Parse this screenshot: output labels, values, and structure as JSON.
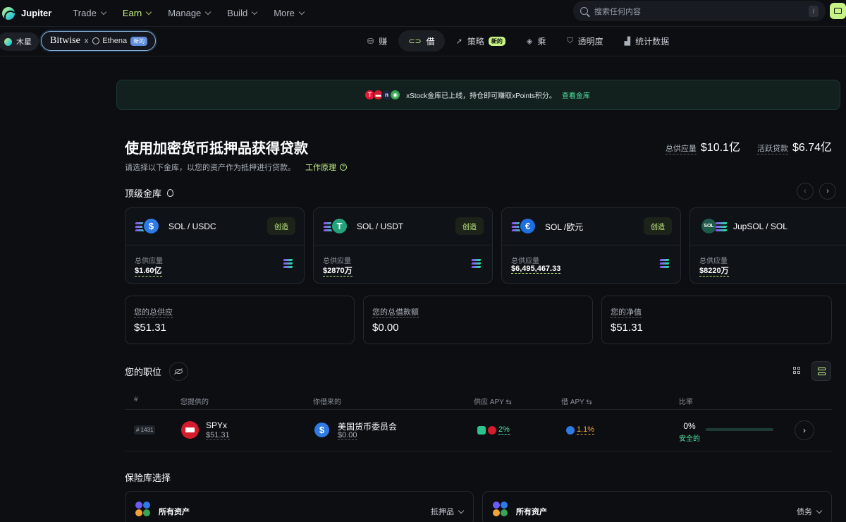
{
  "brand": {
    "name": "Jupiter"
  },
  "nav": [
    {
      "label": "Trade",
      "active": false
    },
    {
      "label": "Earn",
      "active": true
    },
    {
      "label": "Manage",
      "active": false
    },
    {
      "label": "Build",
      "active": false
    },
    {
      "label": "More",
      "active": false
    }
  ],
  "search": {
    "placeholder": "搜索任何内容",
    "shortcut": "/"
  },
  "subnav": {
    "chip_jupiter": "木星",
    "partner": {
      "left": "Bitwise",
      "x": "x",
      "right": "Ethena",
      "badge": "新的"
    },
    "tabs": [
      {
        "label": "赚",
        "icon": "coins-icon",
        "active": false,
        "badge": ""
      },
      {
        "label": "借",
        "icon": "link-icon",
        "active": true,
        "badge": ""
      },
      {
        "label": "策略",
        "icon": "rocket-icon",
        "active": false,
        "badge": "新的"
      },
      {
        "label": "乘",
        "icon": "layers-icon",
        "active": false,
        "badge": ""
      },
      {
        "label": "透明度",
        "icon": "shield-icon",
        "active": false,
        "badge": ""
      },
      {
        "label": "统计数据",
        "icon": "bar-chart-icon",
        "active": false,
        "badge": ""
      }
    ]
  },
  "banner": {
    "text": "xStock金库已上线，持仓即可赚取xPoints积分。",
    "link": "查看金库"
  },
  "hero": {
    "title": "使用加密货币抵押品获得贷款",
    "subtitle": "请选择以下金库，以您的资产作为抵押进行贷款。",
    "how_link": "工作原理",
    "total_supply_label": "总供应量",
    "total_supply_value": "$10.1亿",
    "active_loans_label": "活跃贷款",
    "active_loans_value": "$6.74亿"
  },
  "top_vaults": {
    "title": "顶级金库",
    "cards": [
      {
        "name": "SOL / USDC",
        "token_color": "#2f7ae5",
        "token_glyph": "$",
        "action": "创造",
        "supply_label": "总供应量",
        "supply_value": "$1.60亿"
      },
      {
        "name": "SOL / USDT",
        "token_color": "#26a17b",
        "token_glyph": "T",
        "action": "创造",
        "supply_label": "总供应量",
        "supply_value": "$2870万"
      },
      {
        "name": "SOL /欧元",
        "token_color": "#1e6fe0",
        "token_glyph": "€",
        "action": "创造",
        "supply_label": "总供应量",
        "supply_value": "$6,495,467.33"
      },
      {
        "name": "JupSOL / SOL",
        "token_color": "#1f5b4a",
        "token_glyph": "SOL",
        "action": "",
        "supply_label": "总供应量",
        "supply_value": "$8220万"
      }
    ]
  },
  "summary": [
    {
      "label": "您的总供应",
      "value": "$51.31"
    },
    {
      "label": "您的总借款额",
      "value": "$0.00"
    },
    {
      "label": "您的净值",
      "value": "$51.31"
    }
  ],
  "positions": {
    "title": "您的职位",
    "headers": {
      "id": "#",
      "supplied": "您提供的",
      "borrowed": "你借来的",
      "supply_apy": "供应 APY ⇆",
      "borrow_apy": "借 APY ⇆",
      "ratio": "比率"
    },
    "rows": [
      {
        "id": "# 1431",
        "supplied_name": "SPYx",
        "supplied_value": "$51.31",
        "borrowed_name": "美国货币委员会",
        "borrowed_value": "$0.00",
        "supply_apy": "2%",
        "borrow_apy": "1.1%",
        "ratio": "0%",
        "status": "安全的",
        "ratio_fraction": 0
      }
    ]
  },
  "vault_selection": {
    "title": "保险库选择",
    "left": {
      "label": "所有资产",
      "dropdown": "抵押品"
    },
    "right": {
      "label": "所有资产",
      "dropdown": "债务"
    }
  },
  "colors": {
    "accent": "#c7f284",
    "success": "#4fe3a0",
    "warning": "#f0a53a",
    "background": "#0c0e12"
  }
}
